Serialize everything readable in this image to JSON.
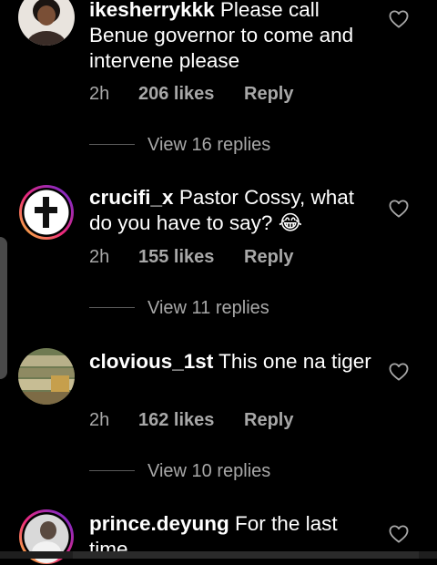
{
  "comments": [
    {
      "username": "ikesherrykkk",
      "text": "Please call Benue governor to come and intervene please",
      "time": "2h",
      "likes": "206 likes",
      "reply_label": "Reply",
      "view_replies": "View 16 replies"
    },
    {
      "username": "crucifi_x",
      "text": "Pastor Cossy, what do you have to say? 😂",
      "time": "2h",
      "likes": "155 likes",
      "reply_label": "Reply",
      "view_replies": "View 11 replies"
    },
    {
      "username": "clovious_1st",
      "text": "This one na tiger",
      "time": "2h",
      "likes": "162 likes",
      "reply_label": "Reply",
      "view_replies": "View 10 replies"
    },
    {
      "username": "prince.deyung",
      "text": "For the last time",
      "time": "",
      "likes": "",
      "reply_label": "",
      "view_replies": ""
    }
  ],
  "icons": {
    "like": "heart-outline-icon"
  },
  "colors": {
    "background": "#000000",
    "text_primary": "#ffffff",
    "text_secondary": "#a8a8a8",
    "story_ring_start": "#f9ce34",
    "story_ring_mid": "#ee2a7b",
    "story_ring_end": "#6228d7"
  }
}
